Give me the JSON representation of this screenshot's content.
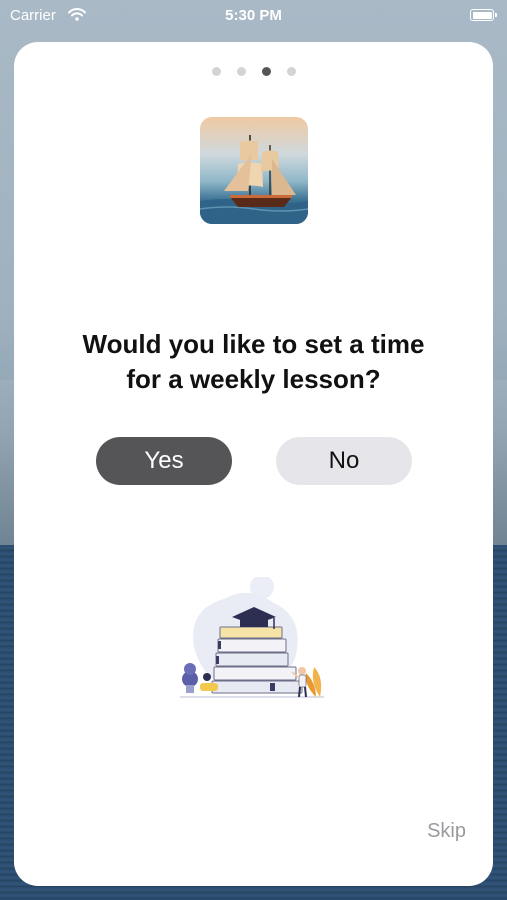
{
  "status_bar": {
    "carrier": "Carrier",
    "time": "5:30 PM"
  },
  "onboarding": {
    "page_count": 4,
    "active_page": 3,
    "question_line1": "Would you like to set a time",
    "question_line2": "for a weekly lesson?",
    "yes_label": "Yes",
    "no_label": "No",
    "skip_label": "Skip"
  },
  "colors": {
    "primary_button": "#555558",
    "secondary_button": "#e6e6ea",
    "skip_text": "#9a9a9e"
  }
}
